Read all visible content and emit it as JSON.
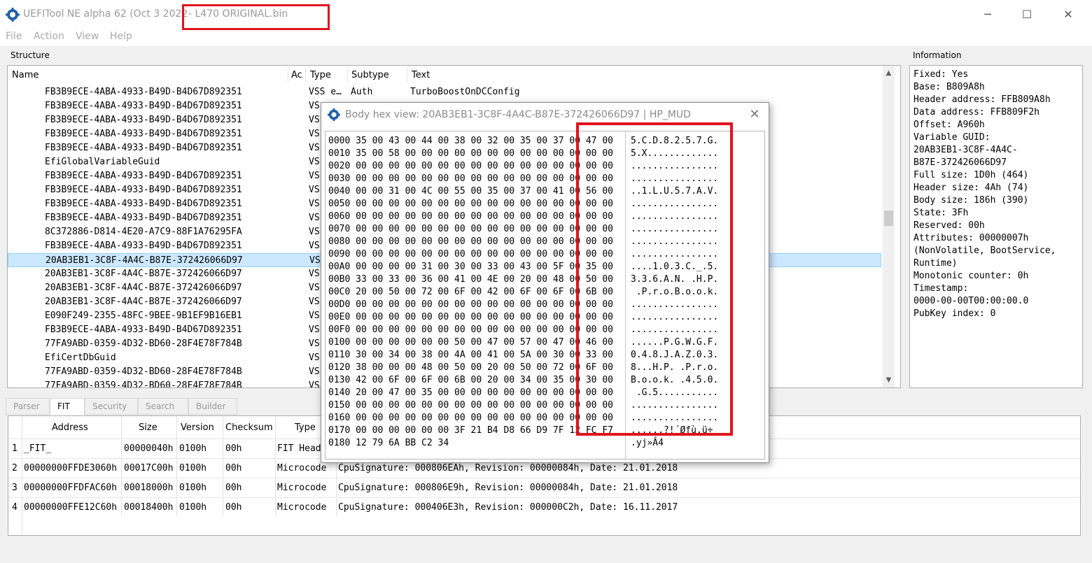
{
  "window": {
    "title": "UEFITool NE alpha 62 (Oct  3 2022",
    "file": "- L470 ORIGINAL.bin",
    "min_glyph": "─",
    "max_glyph": "☐",
    "close_glyph": "✕"
  },
  "menu": [
    "File",
    "Action",
    "View",
    "Help"
  ],
  "structure": {
    "title": "Structure",
    "columns": {
      "name": "Name",
      "action": "Ac",
      "type": "Type",
      "subtype": "Subtype",
      "text": "Text"
    },
    "rows": [
      {
        "name": "FB3B9ECE-4ABA-4933-B49D-B4D67D892351",
        "type": "VSS e…",
        "subtype": "Auth",
        "text": "TurboBoostOnDCConfig"
      },
      {
        "name": "FB3B9ECE-4ABA-4933-B49D-B4D67D892351",
        "type": "VS"
      },
      {
        "name": "FB3B9ECE-4ABA-4933-B49D-B4D67D892351",
        "type": "VS"
      },
      {
        "name": "FB3B9ECE-4ABA-4933-B49D-B4D67D892351",
        "type": "VS"
      },
      {
        "name": "FB3B9ECE-4ABA-4933-B49D-B4D67D892351",
        "type": "VS"
      },
      {
        "name": "EfiGlobalVariableGuid",
        "type": "VS"
      },
      {
        "name": "FB3B9ECE-4ABA-4933-B49D-B4D67D892351",
        "type": "VS"
      },
      {
        "name": "FB3B9ECE-4ABA-4933-B49D-B4D67D892351",
        "type": "VS"
      },
      {
        "name": "FB3B9ECE-4ABA-4933-B49D-B4D67D892351",
        "type": "VS"
      },
      {
        "name": "FB3B9ECE-4ABA-4933-B49D-B4D67D892351",
        "type": "VS"
      },
      {
        "name": "8C372886-D814-4E20-A7C9-88F1A76295FA",
        "type": "VS"
      },
      {
        "name": "FB3B9ECE-4ABA-4933-B49D-B4D67D892351",
        "type": "VS"
      },
      {
        "name": "20AB3EB1-3C8F-4A4C-B87E-372426066D97",
        "type": "VS",
        "selected": true
      },
      {
        "name": "20AB3EB1-3C8F-4A4C-B87E-372426066D97",
        "type": "VS"
      },
      {
        "name": "20AB3EB1-3C8F-4A4C-B87E-372426066D97",
        "type": "VS"
      },
      {
        "name": "20AB3EB1-3C8F-4A4C-B87E-372426066D97",
        "type": "VS"
      },
      {
        "name": "E090F249-2355-48FC-9BEE-9B1EF9B16EB1",
        "type": "VS"
      },
      {
        "name": "FB3B9ECE-4ABA-4933-B49D-B4D67D892351",
        "type": "VS"
      },
      {
        "name": "77FA9ABD-0359-4D32-BD60-28F4E78F784B",
        "type": "VS"
      },
      {
        "name": "EfiCertDbGuid",
        "type": "VS"
      },
      {
        "name": "77FA9ABD-0359-4D32-BD60-28F4E78F784B",
        "type": "VS"
      },
      {
        "name": "77FA9ABD-0359-4D32-BD60-28F4E78F784B",
        "type": "VS"
      }
    ]
  },
  "information": {
    "title": "Information",
    "lines": [
      "Fixed: Yes",
      "Base: B809A8h",
      "Header address: FFB809A8h",
      "Data address: FFB809F2h",
      "Offset: A960h",
      "Variable GUID:",
      "20AB3EB1-3C8F-4A4C-",
      "B87E-372426066D97",
      "Full size: 1D0h (464)",
      "Header size: 4Ah (74)",
      "Body size: 186h (390)",
      "State: 3Fh",
      "Reserved: 00h",
      "Attributes: 00000007h",
      "(NonVolatile, BootService,",
      "Runtime)",
      "Monotonic counter: 0h",
      "Timestamp:",
      "0000-00-00T00:00:00.0",
      "PubKey index: 0"
    ]
  },
  "tabs": [
    "Parser",
    "FIT",
    "Security",
    "Search",
    "Builder"
  ],
  "active_tab": "FIT",
  "fit": {
    "columns": [
      "Address",
      "Size",
      "Version",
      "Checksum",
      "Type"
    ],
    "rows": [
      {
        "num": "1",
        "address": "_FIT_",
        "size": "00000040h",
        "version": "0100h",
        "checksum": "00h",
        "type": "FIT Head",
        "info": ""
      },
      {
        "num": "2",
        "address": "00000000FFDE3060h",
        "size": "00017C00h",
        "version": "0100h",
        "checksum": "00h",
        "type": "Microcode",
        "info": "CpuSignature: 000806EAh, Revision: 00000084h, Date: 21.01.2018"
      },
      {
        "num": "3",
        "address": "00000000FFDFAC60h",
        "size": "00018000h",
        "version": "0100h",
        "checksum": "00h",
        "type": "Microcode",
        "info": "CpuSignature: 000806E9h, Revision: 00000084h, Date: 21.01.2018"
      },
      {
        "num": "4",
        "address": "00000000FFE12C60h",
        "size": "00018400h",
        "version": "0100h",
        "checksum": "00h",
        "type": "Microcode",
        "info": "CpuSignature: 000406E3h, Revision: 000000C2h, Date: 16.11.2017"
      }
    ]
  },
  "hex_dialog": {
    "title": "Body hex view: 20AB3EB1-3C8F-4A4C-B87E-372426066D97 | HP_MUD",
    "close_glyph": "✕",
    "hex_lines": [
      "0000 35 00 43 00 44 00 38 00 32 00 35 00 37 00 47 00",
      "0010 35 00 58 00 00 00 00 00 00 00 00 00 00 00 00 00",
      "0020 00 00 00 00 00 00 00 00 00 00 00 00 00 00 00 00",
      "0030 00 00 00 00 00 00 00 00 00 00 00 00 00 00 00 00",
      "0040 00 00 31 00 4C 00 55 00 35 00 37 00 41 00 56 00",
      "0050 00 00 00 00 00 00 00 00 00 00 00 00 00 00 00 00",
      "0060 00 00 00 00 00 00 00 00 00 00 00 00 00 00 00 00",
      "0070 00 00 00 00 00 00 00 00 00 00 00 00 00 00 00 00",
      "0080 00 00 00 00 00 00 00 00 00 00 00 00 00 00 00 00",
      "0090 00 00 00 00 00 00 00 00 00 00 00 00 00 00 00 00",
      "00A0 00 00 00 00 31 00 30 00 33 00 43 00 5F 00 35 00",
      "00B0 33 00 33 00 36 00 41 00 4E 00 20 00 48 00 50 00",
      "00C0 20 00 50 00 72 00 6F 00 42 00 6F 00 6F 00 6B 00",
      "00D0 00 00 00 00 00 00 00 00 00 00 00 00 00 00 00 00",
      "00E0 00 00 00 00 00 00 00 00 00 00 00 00 00 00 00 00",
      "00F0 00 00 00 00 00 00 00 00 00 00 00 00 00 00 00 00",
      "0100 00 00 00 00 00 00 50 00 47 00 57 00 47 00 46 00",
      "0110 30 00 34 00 38 00 4A 00 41 00 5A 00 30 00 33 00",
      "0120 38 00 00 00 48 00 50 00 20 00 50 00 72 00 6F 00",
      "0130 42 00 6F 00 6F 00 6B 00 20 00 34 00 35 00 30 00",
      "0140 20 00 47 00 35 00 00 00 00 00 00 00 00 00 00 00",
      "0150 00 00 00 00 00 00 00 00 00 00 00 00 00 00 00 00",
      "0160 00 00 00 00 00 00 00 00 00 00 00 00 00 00 00 00",
      "0170 00 00 00 00 00 00 3F 21 B4 D8 66 D9 7F 12 FC F7",
      "0180 12 79 6A BB C2 34"
    ],
    "ascii_lines": [
      "5.C.D.8.2.5.7.G.",
      "5.X.............",
      "................",
      "................",
      "..1.L.U.5.7.A.V.",
      "................",
      "................",
      "................",
      "................",
      "................",
      "....1.0.3.C._.5.",
      "3.3.6.A.N. .H.P.",
      " .P.r.o.B.o.o.k.",
      "................",
      "................",
      "................",
      "......P.G.W.G.F.",
      "0.4.8.J.A.Z.0.3.",
      "8...H.P. .P.r.o.",
      "B.o.o.k. .4.5.0.",
      " .G.5...........",
      "................",
      "................",
      "......?!´Øfù.ü÷",
      ".yj»Â4"
    ]
  },
  "colors": {
    "selection": "#cce8ff",
    "annotation_red": "#e0141e"
  }
}
